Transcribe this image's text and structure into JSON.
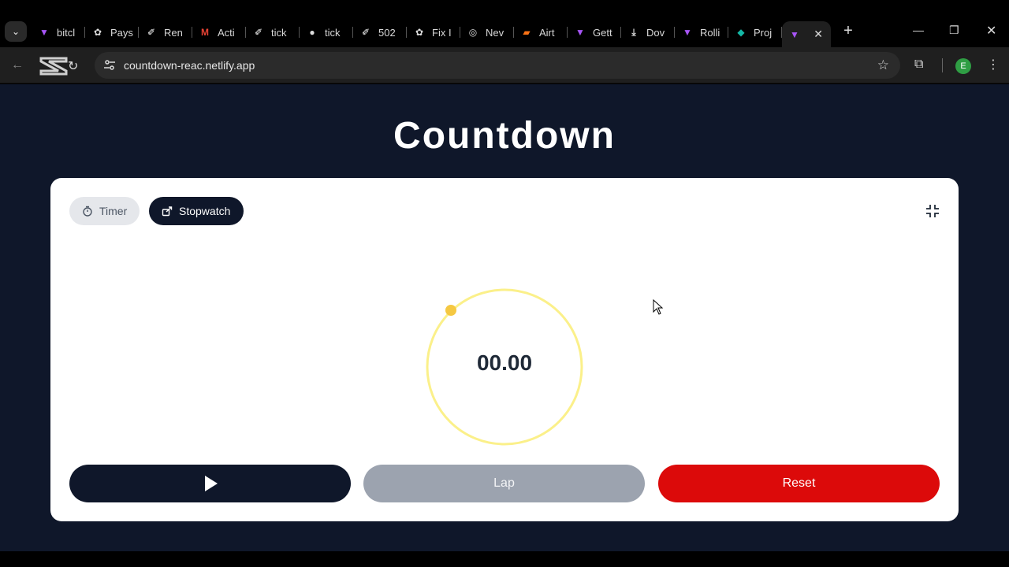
{
  "browser": {
    "tabs": [
      {
        "label": "bitcl",
        "icon": "vite-icon",
        "color": "#a855f7"
      },
      {
        "label": "Pays",
        "icon": "openai-icon",
        "color": "#dddddd"
      },
      {
        "label": "Ren",
        "icon": "render-icon",
        "color": "#ffffff"
      },
      {
        "label": "Acti",
        "icon": "gmail-icon",
        "color": "#ea4335"
      },
      {
        "label": "tick",
        "icon": "render-icon",
        "color": "#ffffff"
      },
      {
        "label": "tick",
        "icon": "globe-icon",
        "color": "#dddddd"
      },
      {
        "label": "502",
        "icon": "render-icon",
        "color": "#ffffff"
      },
      {
        "label": "Fix I",
        "icon": "openai-icon",
        "color": "#dddddd"
      },
      {
        "label": "Nev",
        "icon": "chrome-icon",
        "color": "#dddddd"
      },
      {
        "label": "Airt",
        "icon": "airtable-icon",
        "color": "#f97316"
      },
      {
        "label": "Gett",
        "icon": "vite-icon",
        "color": "#a855f7"
      },
      {
        "label": "Dov",
        "icon": "download-icon",
        "color": "#dddddd"
      },
      {
        "label": "Rolli",
        "icon": "vite-icon",
        "color": "#a855f7"
      },
      {
        "label": "Proj",
        "icon": "netlify-icon",
        "color": "#14b8a6"
      }
    ],
    "url": "countdown-reac.netlify.app",
    "profile_initial": "E"
  },
  "page": {
    "title": "Countdown",
    "modes": {
      "timer": "Timer",
      "stopwatch": "Stopwatch"
    },
    "active_mode": "stopwatch",
    "display_time": "00.00",
    "buttons": {
      "lap": "Lap",
      "reset": "Reset"
    },
    "colors": {
      "ring": "#fbf08a",
      "ring_dot": "#f5c842",
      "reset": "#dc0a0a",
      "dark": "#0f172a"
    }
  }
}
